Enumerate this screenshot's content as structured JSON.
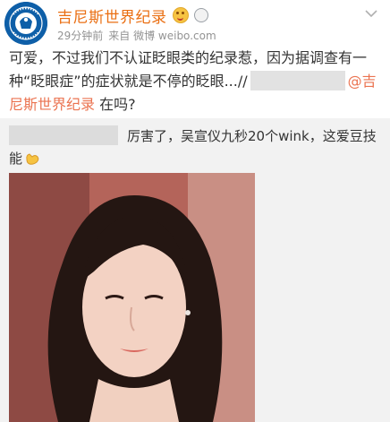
{
  "header": {
    "account_name": "吉尼斯世界纪录",
    "time": "29分钟前",
    "source": "来自 微博 weibo.com",
    "emoji_icon": "grinning-face-icon",
    "level_icon": "level-badge-icon",
    "menu_icon": "chevron-down-icon",
    "avatar_text": "GUINNESS WORLD RECORDS",
    "avatar_color": "#0e5fa8"
  },
  "post": {
    "text_before": "可爱，不过我们不认证眨眼类的纪录惹，因为据调查有一种“眨眼症”的症状就是不停的眨眼...//",
    "mention": "@吉尼斯世界纪录",
    "text_after": " 在吗?"
  },
  "repost": {
    "text": "厉害了，吴宣仪九秒20个wink，这爱豆技能",
    "emoji_icon": "clap-hands-icon"
  },
  "photo": {
    "description_icon": "portrait-photo"
  },
  "colors": {
    "name": "#ea6f13",
    "mention": "#eb7350",
    "meta": "#939393",
    "repost_bg": "#f2f2f2"
  }
}
